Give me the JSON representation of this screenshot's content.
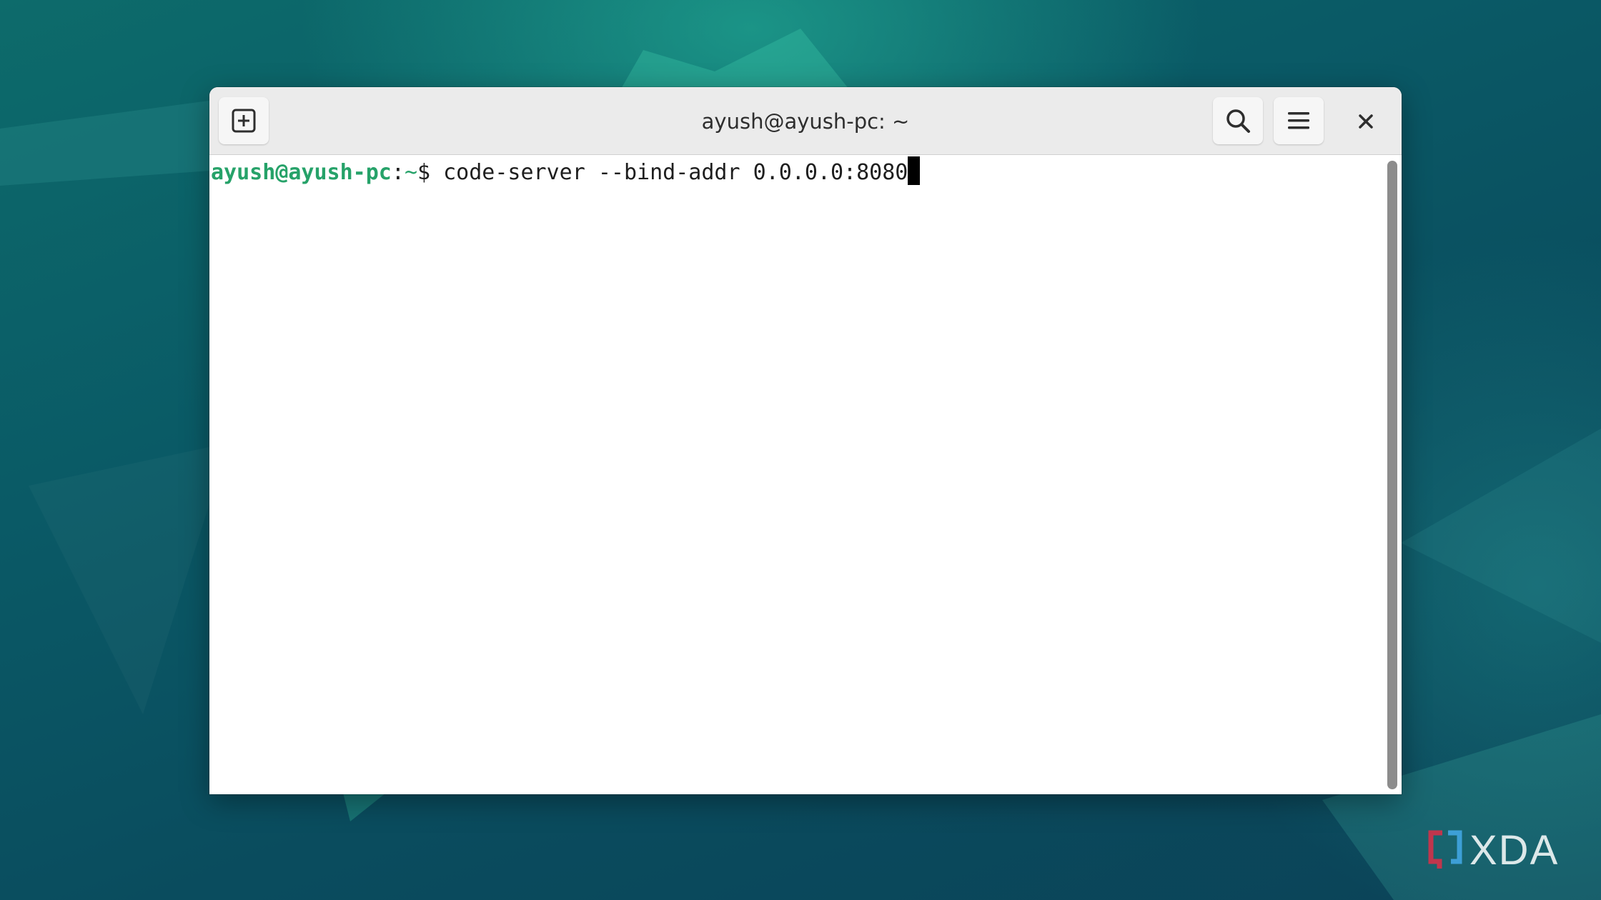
{
  "window": {
    "title": "ayush@ayush-pc: ~"
  },
  "headerbar": {
    "new_tab_icon": "new-tab-plus-square-icon",
    "search_icon": "search-icon",
    "menu_icon": "hamburger-menu-icon",
    "close_icon": "close-x-icon"
  },
  "terminal": {
    "prompt_user": "ayush@ayush-pc",
    "prompt_sep": ":",
    "prompt_path": "~",
    "prompt_symbol": "$ ",
    "command": "code-server --bind-addr 0.0.0.0:8080"
  },
  "branding": {
    "logo_text": "XDA"
  },
  "colors": {
    "prompt": "#26a269",
    "background": "#0a5a66",
    "headerbar": "#ebebeb"
  }
}
